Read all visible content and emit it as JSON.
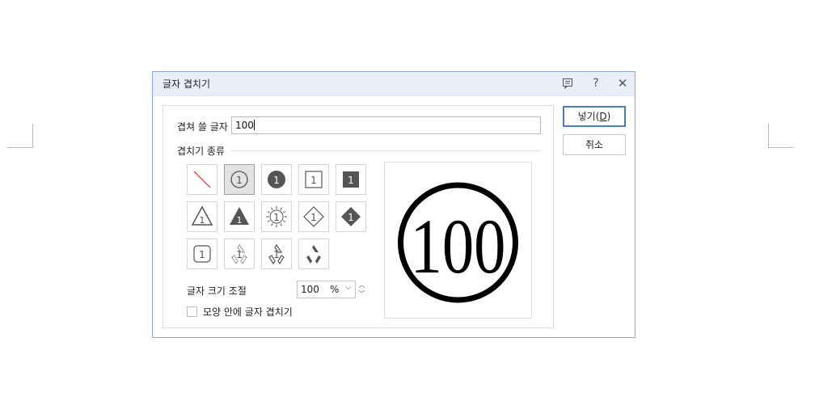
{
  "dialog": {
    "title": "글자 겹치기",
    "text_label": "겹쳐 쓸 글자",
    "text_value": "100",
    "kind_label": "겹치기 종류",
    "size_label": "글자 크기 조절",
    "size_value": "100",
    "size_unit": "%",
    "checkbox_label": "모양 안에 글자 겹치기",
    "checkbox_checked": false,
    "ok_label_prefix": "넣기(",
    "ok_label_key": "D",
    "ok_label_suffix": ")",
    "cancel_label": "취소",
    "preview_text": "100",
    "selected_shape": "circle-outline",
    "shape_digit": "1",
    "shapes": [
      "none-slash",
      "circle-outline",
      "circle-filled",
      "square-outline",
      "square-filled",
      "triangle-outline",
      "triangle-filled",
      "sun-outline",
      "diamond-outline",
      "diamond-filled",
      "rounded-square-outline",
      "recycle-dotted",
      "recycle-outline",
      "recycle-filled"
    ]
  },
  "colors": {
    "accent": "#4a7ad0",
    "slash": "#e05040",
    "filled": "#555555"
  }
}
